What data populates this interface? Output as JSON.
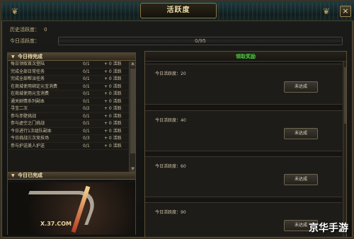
{
  "window": {
    "title": "活跃度",
    "close_glyph": "×",
    "corner_left_glyph": "❦",
    "corner_right_glyph": "❦"
  },
  "stats": {
    "history_label": "历史活跃度：",
    "history_value": "0",
    "today_label": "今日活跃度：",
    "progress_text": "0/95",
    "progress_fraction": 0
  },
  "left": {
    "pending_title": "今日待完成",
    "completed_title": "今日已完成",
    "tasks": [
      {
        "name": "每日领取首次登陆",
        "progress": "0/1",
        "points": "+ 0 活跃"
      },
      {
        "name": "完成全部日常任务",
        "progress": "0/1",
        "points": "+ 0 活跃"
      },
      {
        "name": "完成全部帮派任务",
        "progress": "0/1",
        "points": "+ 0 活跃"
      },
      {
        "name": "在商城使用绑定元宝消费",
        "progress": "0/1",
        "points": "+ 0 活跃"
      },
      {
        "name": "在商城使用元宝消费",
        "progress": "0/1",
        "points": "+ 0 活跃"
      },
      {
        "name": "通关剧情系列副本",
        "progress": "0/1",
        "points": "+ 0 活跃"
      },
      {
        "name": "寻宝二次",
        "progress": "0/2",
        "points": "+ 0 活跃"
      },
      {
        "name": "参与赤壁挑战",
        "progress": "0/1",
        "points": "+ 0 活跃"
      },
      {
        "name": "参与虚空之门挑战",
        "progress": "0/1",
        "points": "+ 0 活跃"
      },
      {
        "name": "今日进行1次组队副本",
        "progress": "0/1",
        "points": "+ 0 活跃"
      },
      {
        "name": "今日挑战三次竞技场",
        "progress": "0/3",
        "points": "+ 0 活跃"
      },
      {
        "name": "参与护送美人护送",
        "progress": "0/1",
        "points": "+ 0 活跃"
      }
    ],
    "logo_text": "X.37.COM"
  },
  "right": {
    "header": "领取奖励",
    "rewards": [
      {
        "label": "今日活跃度：20",
        "button": "未达成"
      },
      {
        "label": "今日活跃度：40",
        "button": "未达成"
      },
      {
        "label": "今日活跃度：60",
        "button": "未达成"
      },
      {
        "label": "今日活跃度：90",
        "button": "未达成"
      }
    ]
  },
  "watermark": "京华手游",
  "icons": {
    "expand_triangle": "▼",
    "scroll_up": "▲",
    "scroll_down": "▼"
  }
}
